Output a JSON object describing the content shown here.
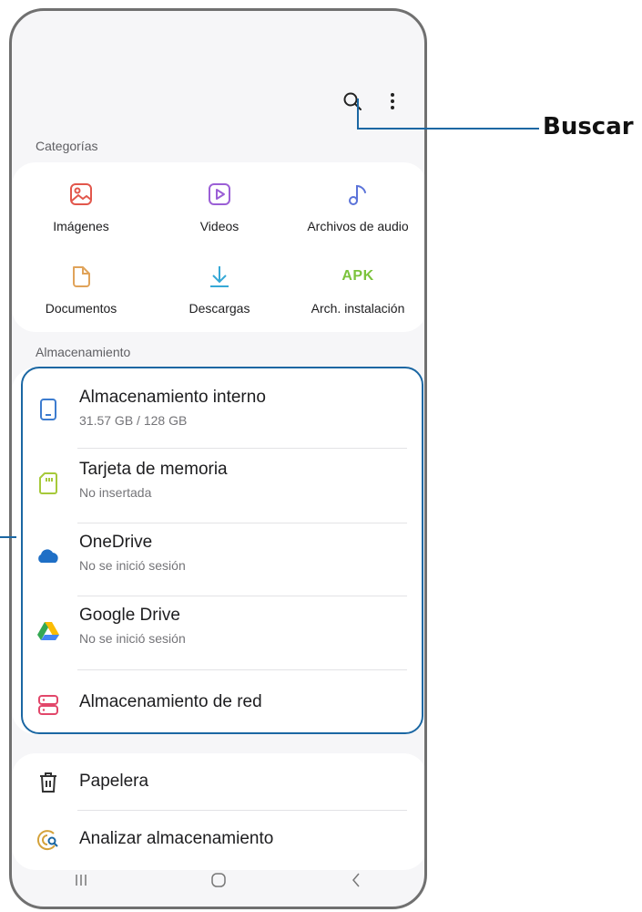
{
  "callout": {
    "label": "Buscar"
  },
  "toolbar": {
    "search_icon": "search-icon",
    "more_icon": "more-vert-icon"
  },
  "categories": {
    "label": "Categorías",
    "items": [
      {
        "label": "Imágenes",
        "icon": "image-icon",
        "color": "#e2574c"
      },
      {
        "label": "Videos",
        "icon": "video-icon",
        "color": "#9b5fd6"
      },
      {
        "label": "Archivos de audio",
        "icon": "music-note-icon",
        "color": "#5b73d9"
      },
      {
        "label": "Documentos",
        "icon": "document-icon",
        "color": "#e0a35a"
      },
      {
        "label": "Descargas",
        "icon": "download-icon",
        "color": "#36a8d6"
      },
      {
        "label": "Arch. instalación",
        "icon": "apk-icon",
        "icon_text": "APK",
        "color": "#7bc33c"
      }
    ]
  },
  "storage": {
    "label": "Almacenamiento",
    "items": [
      {
        "title": "Almacenamiento interno",
        "subtitle": "31.57 GB / 128 GB",
        "icon": "phone-storage-icon",
        "color": "#3d7ccf"
      },
      {
        "title": "Tarjeta de memoria",
        "subtitle": "No insertada",
        "icon": "sd-card-icon",
        "color": "#a6c93a"
      },
      {
        "title": "OneDrive",
        "subtitle": "No se inició sesión",
        "icon": "onedrive-icon",
        "color": "#1f6fc6"
      },
      {
        "title": "Google Drive",
        "subtitle": "No se inició sesión",
        "icon": "google-drive-icon",
        "color": "#34a853"
      },
      {
        "title": "Almacenamiento de red",
        "subtitle": "",
        "icon": "network-storage-icon",
        "color": "#e2476a"
      }
    ]
  },
  "other": {
    "items": [
      {
        "title": "Papelera",
        "icon": "trash-icon"
      },
      {
        "title": "Analizar almacenamiento",
        "icon": "analyze-storage-icon",
        "color": "#d4a23a"
      }
    ]
  },
  "navbar": {
    "recent_icon": "recent-apps-icon",
    "home_icon": "home-icon",
    "back_icon": "back-icon"
  }
}
